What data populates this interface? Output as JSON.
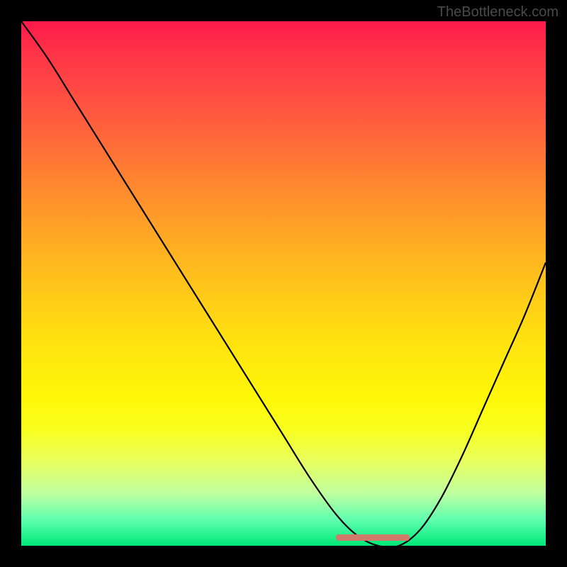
{
  "watermark": "TheBottleneck.com",
  "chart_data": {
    "type": "line",
    "title": "",
    "xlabel": "",
    "ylabel": "",
    "xlim": [
      0,
      1
    ],
    "ylim": [
      0,
      1
    ],
    "series": [
      {
        "name": "bottleneck-curve",
        "x": [
          0.0,
          0.05,
          0.1,
          0.15,
          0.2,
          0.25,
          0.3,
          0.35,
          0.4,
          0.45,
          0.5,
          0.55,
          0.6,
          0.64,
          0.68,
          0.72,
          0.76,
          0.8,
          0.84,
          0.88,
          0.92,
          0.96,
          1.0
        ],
        "values": [
          1.0,
          0.93,
          0.85,
          0.77,
          0.69,
          0.61,
          0.53,
          0.45,
          0.37,
          0.29,
          0.21,
          0.13,
          0.06,
          0.02,
          0.0,
          0.0,
          0.03,
          0.09,
          0.17,
          0.26,
          0.35,
          0.44,
          0.54
        ]
      }
    ],
    "annotations": [
      {
        "name": "optimal-range",
        "x_start": 0.6,
        "x_end": 0.74,
        "y": 0.0
      }
    ],
    "background_gradient": {
      "top": "#ff1a4a",
      "mid": "#ffe010",
      "bottom": "#00e878"
    }
  }
}
